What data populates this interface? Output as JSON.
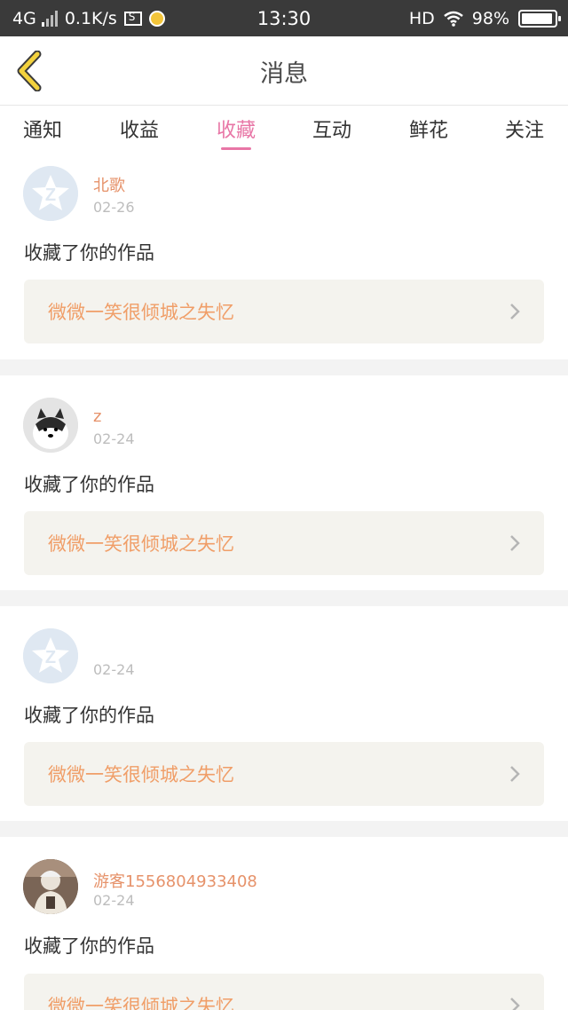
{
  "status_bar": {
    "network": "4G",
    "speed": "0.1K/s",
    "time": "13:30",
    "hd": "HD",
    "battery": "98%"
  },
  "header": {
    "title": "消息",
    "back_icon": "chevron-left-icon"
  },
  "tabs": [
    {
      "label": "通知",
      "active": false
    },
    {
      "label": "收益",
      "active": false
    },
    {
      "label": "收藏",
      "active": true
    },
    {
      "label": "互动",
      "active": false
    },
    {
      "label": "鲜花",
      "active": false
    },
    {
      "label": "关注",
      "active": false
    }
  ],
  "items": [
    {
      "name": "北歌",
      "date": "02-26",
      "action": "收藏了你的作品",
      "work": "微微一笑很倾城之失忆",
      "avatar": "qq-default"
    },
    {
      "name": "z",
      "date": "02-24",
      "action": "收藏了你的作品",
      "work": "微微一笑很倾城之失忆",
      "avatar": "dog-photo"
    },
    {
      "name": "",
      "date": "02-24",
      "action": "收藏了你的作品",
      "work": "微微一笑很倾城之失忆",
      "avatar": "qq-default"
    },
    {
      "name": "游客1556804933408",
      "date": "02-24",
      "action": "收藏了你的作品",
      "work": "微微一笑很倾城之失忆",
      "avatar": "person-photo"
    }
  ],
  "colors": {
    "accent": "#e876a6",
    "name": "#e6926a",
    "work": "#f09e68",
    "card_bg": "#f4f3ee"
  }
}
